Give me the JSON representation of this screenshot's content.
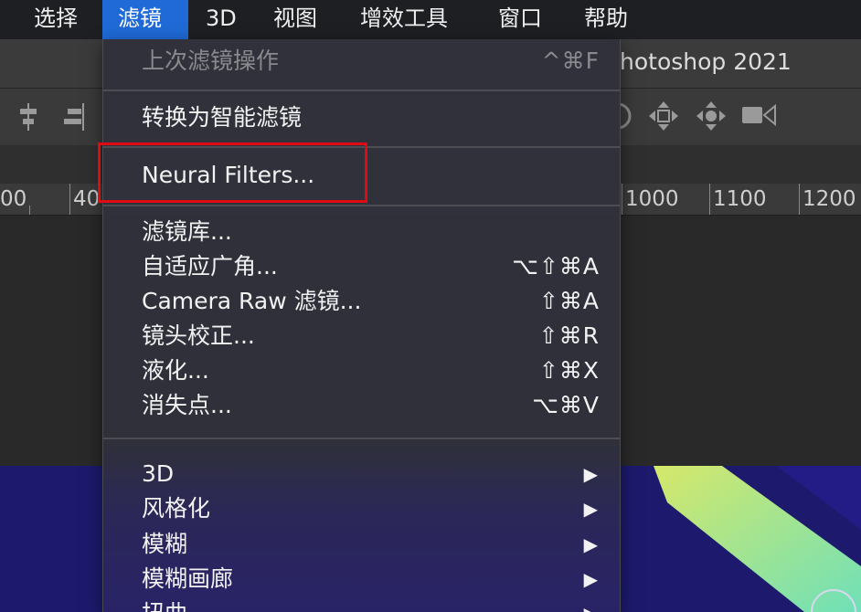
{
  "menubar": {
    "items": [
      "选择",
      "滤镜",
      "3D",
      "视图",
      "增效工具",
      "窗口",
      "帮助"
    ],
    "active_index": 1
  },
  "window": {
    "title_visible": "hotoshop 2021"
  },
  "ruler": {
    "labels": [
      "00",
      "40",
      "1000",
      "1100",
      "1200"
    ]
  },
  "filter_menu": {
    "last_filter": {
      "label": "上次滤镜操作",
      "shortcut": "^⌘F"
    },
    "convert_smart": {
      "label": "转换为智能滤镜"
    },
    "neural_filters": {
      "label": "Neural Filters..."
    },
    "group1": [
      {
        "label": "滤镜库...",
        "shortcut": ""
      },
      {
        "label": "自适应广角...",
        "shortcut": "⌥⇧⌘A"
      },
      {
        "label": "Camera Raw 滤镜...",
        "shortcut": "⇧⌘A"
      },
      {
        "label": "镜头校正...",
        "shortcut": "⇧⌘R"
      },
      {
        "label": "液化...",
        "shortcut": "⇧⌘X"
      },
      {
        "label": "消失点...",
        "shortcut": "⌥⌘V"
      }
    ],
    "submenus": [
      {
        "label": "3D",
        "arrow": "▶"
      },
      {
        "label": "风格化",
        "arrow": "▶"
      },
      {
        "label": "模糊",
        "arrow": "▶"
      },
      {
        "label": "模糊画廊",
        "arrow": "▶"
      },
      {
        "label": "扭曲",
        "arrow": "▶"
      }
    ]
  },
  "colors": {
    "accent": "#1f6ad6",
    "highlight_box": "#e00a12",
    "artwork_bg": "#1d1a6e"
  },
  "icons": [
    "align-center-icon",
    "align-right-icon",
    "orbit-3d-icon",
    "pan-3d-icon",
    "move-3d-icon",
    "video-camera-icon"
  ]
}
